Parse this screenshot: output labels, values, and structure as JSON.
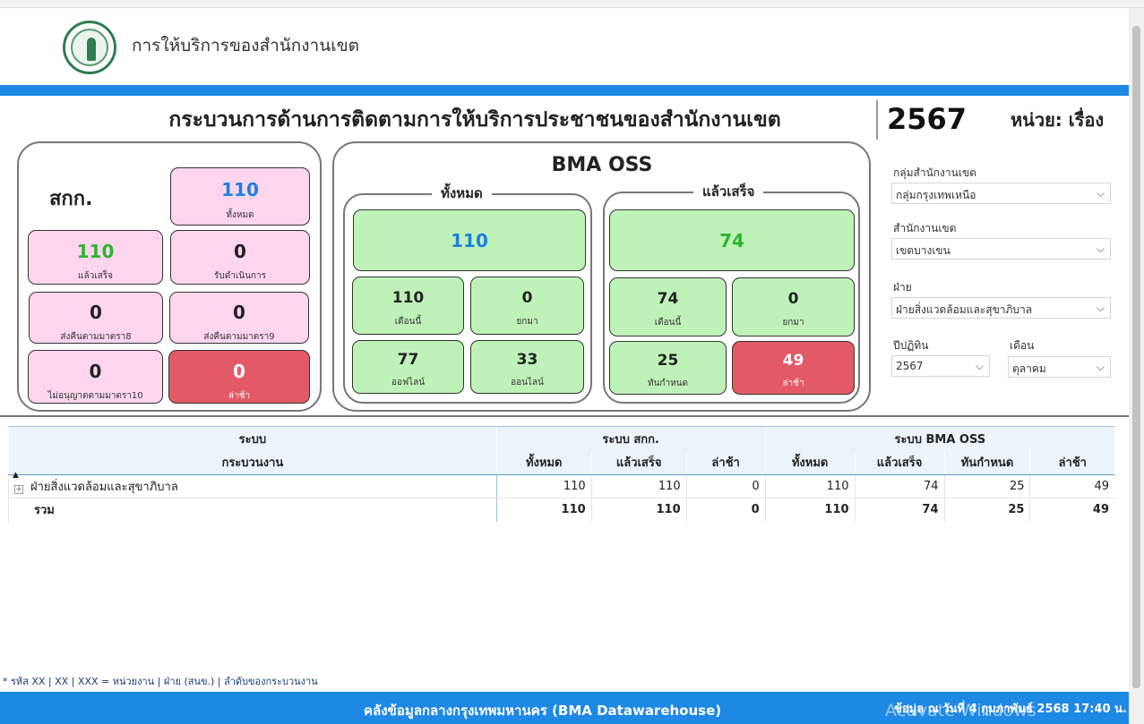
{
  "header": {
    "title": "การให้บริการของสำนักงานเขต"
  },
  "main_title": "กระบวนการด้านการติดตามการให้บริการประชาชนของสำนักงานเขต",
  "year": "2567",
  "unit": "หน่วย: เรื่อง",
  "skk": {
    "label": "สกก.",
    "total": {
      "value": "110",
      "label": "ทั้งหมด"
    },
    "done": {
      "value": "110",
      "label": "แล้วเสร็จ"
    },
    "processing": {
      "value": "0",
      "label": "รับดำเนินการ"
    },
    "return8": {
      "value": "0",
      "label": "ส่งคืนตามมาตรา8"
    },
    "return9": {
      "value": "0",
      "label": "ส่งคืนตามมาตรา9"
    },
    "deny10": {
      "value": "0",
      "label": "ไม่อนุญาตตามมาตรา10"
    },
    "late": {
      "value": "0",
      "label": "ล่าช้า"
    }
  },
  "oss": {
    "title": "BMA OSS",
    "all": {
      "title": "ทั้งหมด",
      "total": "110",
      "this_month": {
        "value": "110",
        "label": "เดือนนี้"
      },
      "carried": {
        "value": "0",
        "label": "ยกมา"
      },
      "offline": {
        "value": "77",
        "label": "ออฟไลน์"
      },
      "online": {
        "value": "33",
        "label": "ออนไลน์"
      }
    },
    "done": {
      "title": "แล้วเสร็จ",
      "total": "74",
      "this_month": {
        "value": "74",
        "label": "เดือนนี้"
      },
      "carried": {
        "value": "0",
        "label": "ยกมา"
      },
      "on_time": {
        "value": "25",
        "label": "ทันกำหนด"
      },
      "late": {
        "value": "49",
        "label": "ล่าช้า"
      }
    }
  },
  "filters": {
    "group": {
      "label": "กลุ่มสำนักงานเขต",
      "value": "กลุ่มกรุงเทพเหนือ"
    },
    "district": {
      "label": "สำนักงานเขต",
      "value": "เขตบางเขน"
    },
    "division": {
      "label": "ฝ่าย",
      "value": "ฝ่ายสิ่งแวดล้อมและสุขาภิบาล"
    },
    "fiscal_year": {
      "label": "ปีปฏิทิน",
      "value": "2567"
    },
    "month": {
      "label": "เดือน",
      "value": "ตุลาคม"
    }
  },
  "table": {
    "group_headers": [
      "ระบบ",
      "ระบบ สกก.",
      "ระบบ BMA OSS"
    ],
    "columns": [
      "กระบวนงาน",
      "ทั้งหมด",
      "แล้วเสร็จ",
      "ล่าช้า",
      "ทั้งหมด",
      "แล้วเสร็จ",
      "ทันกำหนด",
      "ล่าช้า"
    ],
    "rows": [
      [
        "ฝ่ายสิ่งแวดล้อมและสุขาภิบาล",
        "110",
        "110",
        "0",
        "110",
        "74",
        "25",
        "49"
      ]
    ],
    "total": [
      "รวม",
      "110",
      "110",
      "0",
      "110",
      "74",
      "25",
      "49"
    ]
  },
  "footnote": "* รหัส XX | XX | XXX = หน่วยงาน | ฝ่าย (สนข.) | ลำดับของกระบวนงาน",
  "footer": {
    "center": "คลังข้อมูลกลางกรุงเทพมหานคร (BMA Datawarehouse)",
    "right": "ข้อมูล ณ วันที่ 4 กุมภาพันธ์ 2568 17:40 น."
  },
  "watermark": "Activate Windows",
  "icons": {
    "dropdown": "chevron-down-icon",
    "expand": "plus-box-icon",
    "sort": "sort-up-icon"
  },
  "colors": {
    "accent": "#1e88e5",
    "pink_card": "#fdd6ee",
    "green_card": "#bff2b8",
    "late_card": "#e35a66",
    "value_blue": "#1e7fe0",
    "value_green": "#2bb52b"
  }
}
